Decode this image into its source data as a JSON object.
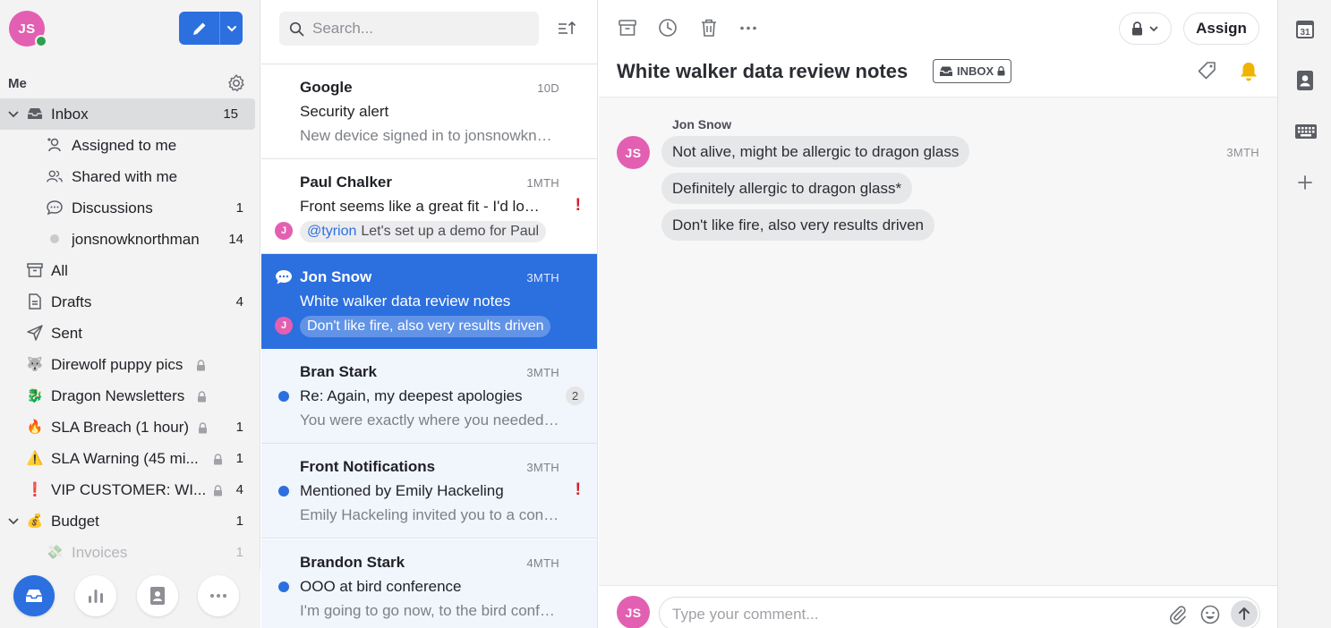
{
  "user": {
    "initials": "JS",
    "status": "online"
  },
  "sidebar": {
    "section_label": "Me",
    "items": [
      {
        "label": "Inbox",
        "count": "15",
        "icon": "inbox-icon",
        "active": true
      },
      {
        "label": "Assigned to me",
        "count": "",
        "icon": "assigned-user-icon"
      },
      {
        "label": "Shared with me",
        "count": "",
        "icon": "shared-users-icon"
      },
      {
        "label": "Discussions",
        "count": "1",
        "icon": "chat-bubble-icon"
      },
      {
        "label": "jonsnowknorthman",
        "count": "14",
        "icon": "dot-icon"
      },
      {
        "label": "All",
        "count": "",
        "icon": "archive-box-icon"
      },
      {
        "label": "Drafts",
        "count": "4",
        "icon": "document-icon"
      },
      {
        "label": "Sent",
        "count": "",
        "icon": "paper-plane-icon"
      },
      {
        "label": "Direwolf puppy pics",
        "count": "",
        "icon": "wolf-emoji-icon",
        "emoji": "🐺",
        "locked": true
      },
      {
        "label": "Dragon Newsletters",
        "count": "",
        "icon": "dragon-emoji-icon",
        "emoji": "🐉",
        "locked": true
      },
      {
        "label": "SLA Breach (1 hour)",
        "count": "1",
        "icon": "fire-emoji-icon",
        "emoji": "🔥",
        "locked": true
      },
      {
        "label": "SLA Warning (45 mi...",
        "count": "1",
        "icon": "warning-emoji-icon",
        "emoji": "⚠️",
        "locked": true
      },
      {
        "label": "VIP CUSTOMER: WI...",
        "count": "4",
        "icon": "exclamation-emoji-icon",
        "emoji": "❗",
        "locked": true
      },
      {
        "label": "Budget",
        "count": "1",
        "icon": "money-bag-emoji-icon",
        "emoji": "💰"
      },
      {
        "label": "Invoices",
        "count": "1",
        "icon": "money-wings-emoji-icon",
        "emoji": "💸"
      }
    ]
  },
  "search": {
    "placeholder": "Search..."
  },
  "conversations": [
    {
      "sender": "Google",
      "time": "10D",
      "subject": "Security alert",
      "preview": "New device signed in to jonsnowknorthman@gmail.com"
    },
    {
      "sender": "Paul Chalker",
      "time": "1MTH",
      "subject": "Front seems like a great fit - I'd love to learn more",
      "comment_mention": "@tyrion",
      "comment_text": "Let's set up a demo for Paul",
      "comment_initial": "J",
      "urgent": "!"
    },
    {
      "sender": "Jon Snow",
      "time": "3MTH",
      "subject": "White walker data review notes",
      "comment_text": "Don't like fire, also very results driven",
      "comment_initial": "J"
    },
    {
      "sender": "Bran Stark",
      "time": "3MTH",
      "subject": "Re: Again, my deepest apologies",
      "preview": "You were exactly where you needed to be",
      "count": "2"
    },
    {
      "sender": "Front Notifications",
      "time": "3MTH",
      "subject": "Mentioned by Emily Hackeling",
      "preview": "Emily Hackeling invited you to a conversation",
      "urgent": "!"
    },
    {
      "sender": "Brandon Stark",
      "time": "4MTH",
      "subject": "OOO at bird conference",
      "preview": "I'm going to go now, to the bird conference"
    }
  ],
  "detail": {
    "title": "White walker data review notes",
    "inbox_tag": "INBOX",
    "assign_label": "Assign",
    "author": "Jon Snow",
    "author_initials": "JS",
    "time": "3MTH",
    "messages": [
      "Not alive, might be allergic to dragon glass",
      "Definitely allergic to dragon glass*",
      "Don't like fire, also very results driven"
    ],
    "composer_placeholder": "Type your comment...",
    "composer_initials": "JS"
  },
  "rail": {
    "calendar_day": "31"
  },
  "colors": {
    "accent": "#2c6fdf",
    "avatar": "#e35fb1",
    "presence": "#2ba24c",
    "urgent": "#d2202a",
    "bell": "#f0b400"
  }
}
